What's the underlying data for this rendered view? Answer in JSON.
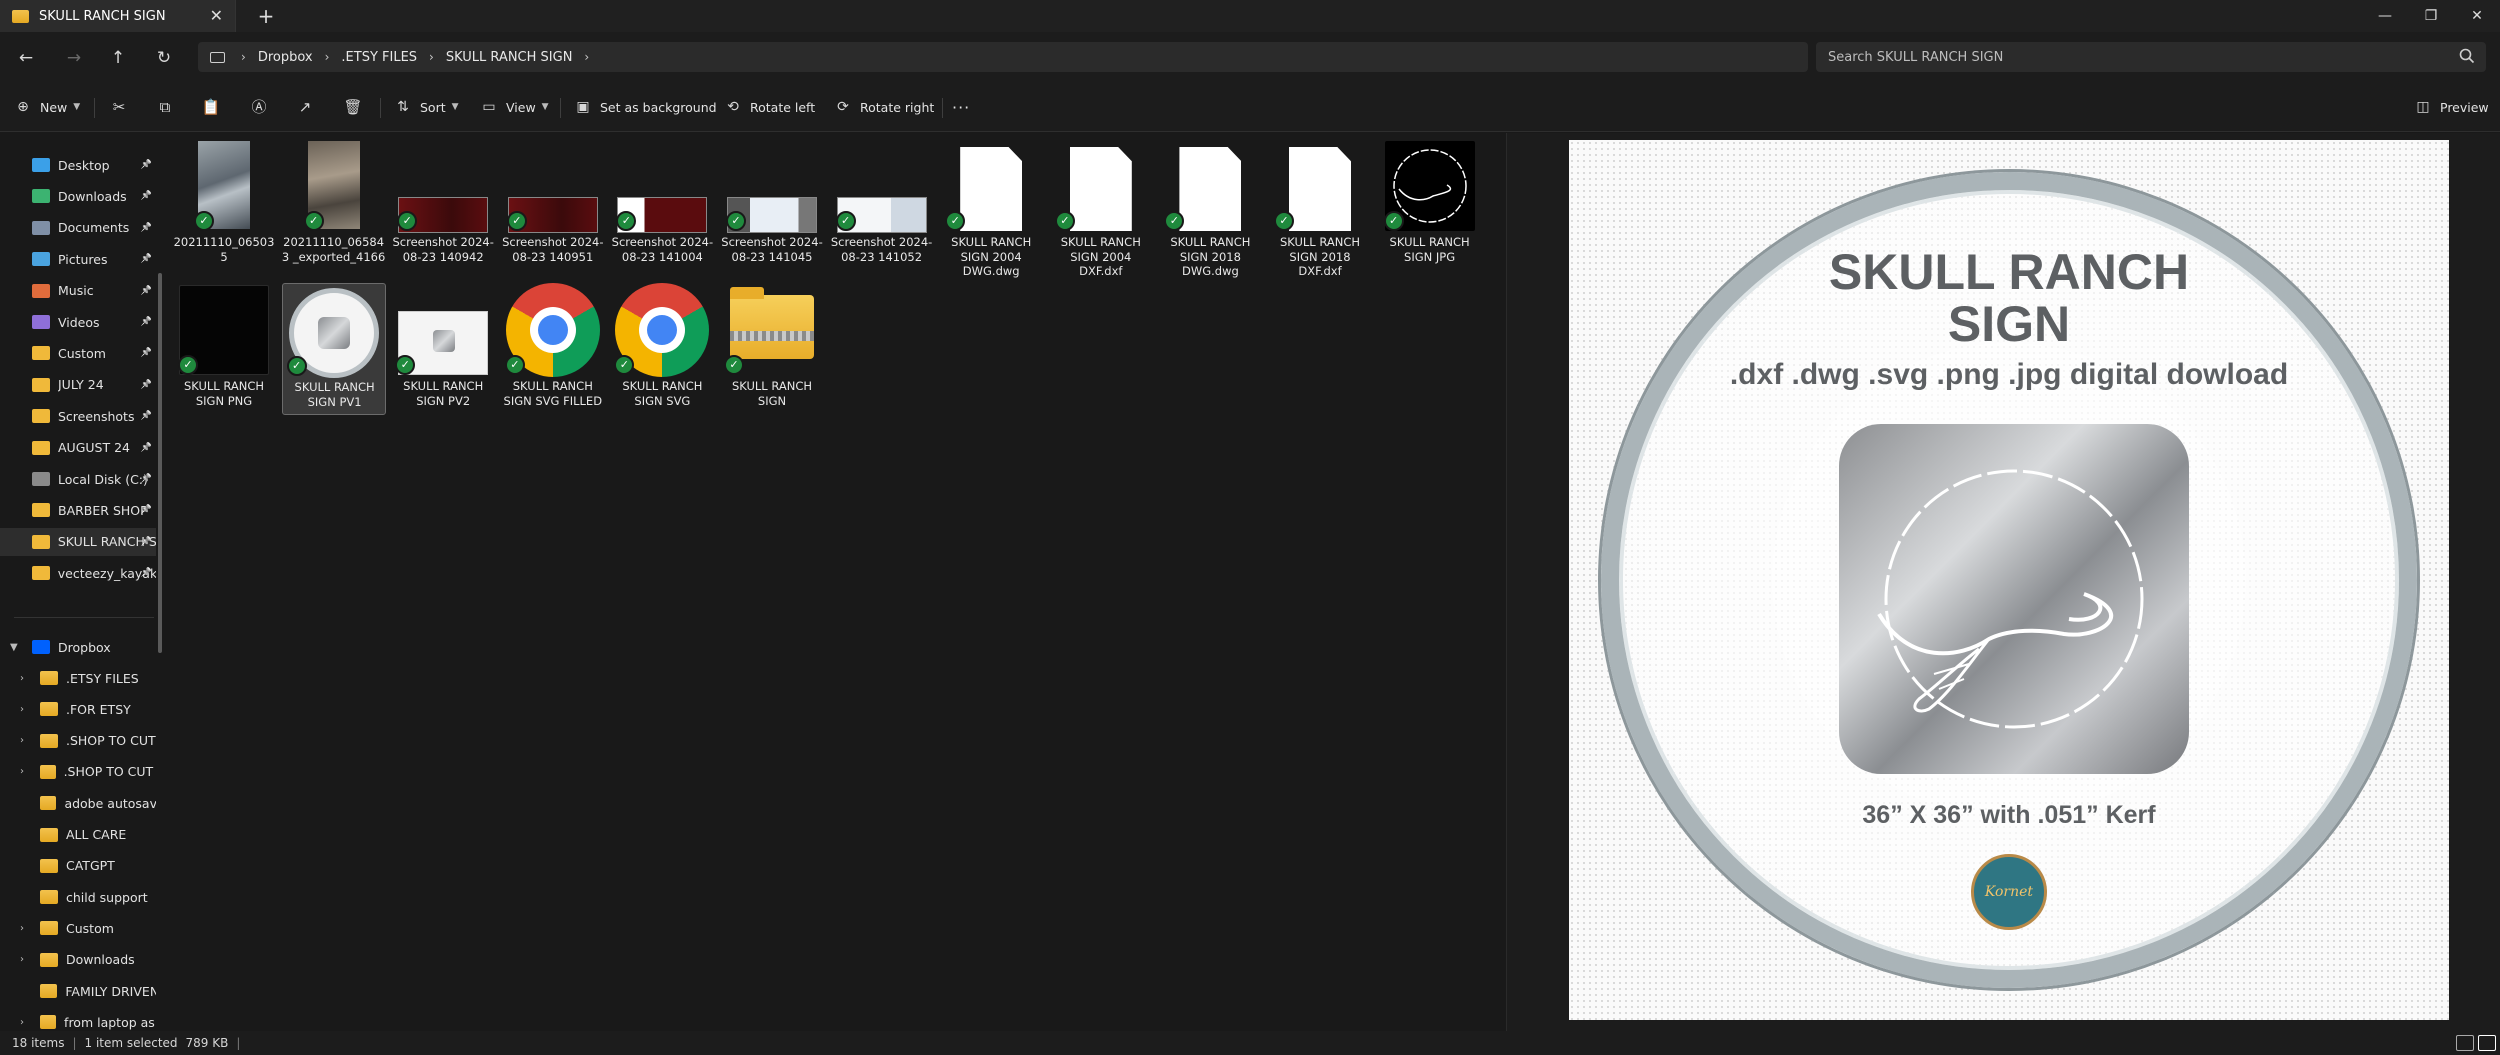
{
  "window": {
    "tab_title": "SKULL RANCH SIGN",
    "tab_close": "✕",
    "new_tab": "+",
    "minimize": "—",
    "maximize": "❐",
    "close": "✕"
  },
  "nav": {
    "back": "←",
    "forward": "→",
    "up": "↑",
    "refresh": "↻"
  },
  "address": {
    "separator": "›",
    "breadcrumbs": [
      "Dropbox",
      ".ETSY FILES",
      "SKULL RANCH SIGN"
    ]
  },
  "search": {
    "placeholder": "Search SKULL RANCH SIGN"
  },
  "toolbar": {
    "new_label": "New",
    "sort_label": "Sort",
    "view_label": "View",
    "set_background_label": "Set as background",
    "rotate_left_label": "Rotate left",
    "rotate_right_label": "Rotate right",
    "more_label": "···",
    "preview_label": "Preview"
  },
  "sidebar": {
    "quick_access": [
      {
        "label": "Desktop",
        "icon": "desktop-icon",
        "color": "#3ba0e8"
      },
      {
        "label": "Downloads",
        "icon": "downloads-icon",
        "color": "#3cb371"
      },
      {
        "label": "Documents",
        "icon": "documents-icon",
        "color": "#7f8fa6"
      },
      {
        "label": "Pictures",
        "icon": "pictures-icon",
        "color": "#4aa3df"
      },
      {
        "label": "Music",
        "icon": "music-icon",
        "color": "#e06c3c"
      },
      {
        "label": "Videos",
        "icon": "videos-icon",
        "color": "#8e6fd8"
      },
      {
        "label": "Custom",
        "icon": "folder-icon",
        "color": "#f0b93a"
      },
      {
        "label": "JULY 24",
        "icon": "folder-icon",
        "color": "#f0b93a"
      },
      {
        "label": "Screenshots",
        "icon": "folder-icon",
        "color": "#f0b93a"
      },
      {
        "label": "AUGUST 24",
        "icon": "folder-icon",
        "color": "#f0b93a"
      },
      {
        "label": "Local Disk (C:)",
        "icon": "drive-icon",
        "color": "#8a8a8a"
      },
      {
        "label": "BARBER SHOP",
        "icon": "folder-icon",
        "color": "#f0b93a"
      },
      {
        "label": "SKULL RANCH S",
        "icon": "folder-icon",
        "color": "#f0b93a"
      },
      {
        "label": "vecteezy_kayak",
        "icon": "folder-icon",
        "color": "#f0b93a"
      }
    ],
    "pin_glyph": "📌",
    "dropbox_label": "Dropbox",
    "dropbox_children": [
      {
        "label": ".ETSY FILES",
        "expandable": true
      },
      {
        "label": ".FOR ETSY",
        "expandable": true
      },
      {
        "label": ".SHOP TO CUT",
        "expandable": true
      },
      {
        "label": ".SHOP TO CUT - (",
        "expandable": true
      },
      {
        "label": "adobe autosave",
        "expandable": false
      },
      {
        "label": "ALL CARE",
        "expandable": false
      },
      {
        "label": "CATGPT",
        "expandable": false
      },
      {
        "label": "child support",
        "expandable": false
      },
      {
        "label": "Custom",
        "expandable": true
      },
      {
        "label": "Downloads",
        "expandable": true
      },
      {
        "label": "FAMILY DRIVEN",
        "expandable": false
      },
      {
        "label": "from laptop as it",
        "expandable": true
      }
    ]
  },
  "files": [
    {
      "name": "20211110_065035",
      "kind": "photo1"
    },
    {
      "name": "20211110_065843 _exported_4166",
      "kind": "photo2"
    },
    {
      "name": "Screenshot 2024-08-23 140942",
      "kind": "shot-red"
    },
    {
      "name": "Screenshot 2024-08-23 140951",
      "kind": "shot-red"
    },
    {
      "name": "Screenshot 2024-08-23 141004",
      "kind": "shot-red2"
    },
    {
      "name": "Screenshot 2024-08-23 141045",
      "kind": "shot-blue"
    },
    {
      "name": "Screenshot 2024-08-23 141052",
      "kind": "shot-blue2"
    },
    {
      "name": "SKULL RANCH SIGN 2004 DWG.dwg",
      "kind": "doc"
    },
    {
      "name": "SKULL RANCH SIGN 2004 DXF.dxf",
      "kind": "doc"
    },
    {
      "name": "SKULL RANCH SIGN 2018 DWG.dwg",
      "kind": "doc"
    },
    {
      "name": "SKULL RANCH SIGN 2018 DXF.dxf",
      "kind": "doc"
    },
    {
      "name": "SKULL RANCH SIGN JPG",
      "kind": "skull-dark"
    },
    {
      "name": "SKULL RANCH SIGN PNG",
      "kind": "black"
    },
    {
      "name": "SKULL RANCH SIGN PV1",
      "kind": "pv1"
    },
    {
      "name": "SKULL RANCH SIGN PV2",
      "kind": "pv2"
    },
    {
      "name": "SKULL RANCH SIGN SVG FILLED",
      "kind": "chrome"
    },
    {
      "name": "SKULL RANCH SIGN SVG",
      "kind": "chrome"
    },
    {
      "name": "SKULL RANCH SIGN",
      "kind": "zip"
    }
  ],
  "preview": {
    "title_line1": "SKULL RANCH",
    "title_line2": "SIGN",
    "formats": ".dxf .dwg .svg .png .jpg digital dowload",
    "size_line": "36” X 36” with .051” Kerf",
    "logo_text": "Kornet"
  },
  "status": {
    "items_count": "18 items",
    "selection": "1 item selected",
    "size": "789 KB"
  },
  "colors": {
    "accent_check": "#1f8a3d",
    "background": "#191919"
  }
}
